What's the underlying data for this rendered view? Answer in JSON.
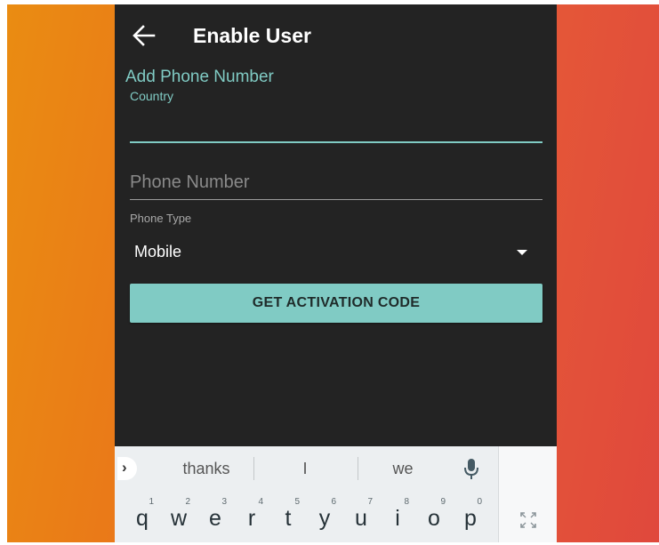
{
  "app_bar": {
    "back_icon": "arrow-left-icon",
    "title": "Enable User"
  },
  "form": {
    "section_title": "Add Phone Number",
    "country_label": "Country",
    "country_value": "",
    "phone_placeholder": "Phone Number",
    "phone_type_label": "Phone Type",
    "phone_type_value": "Mobile",
    "dropdown_icon": "caret-down-icon",
    "activation_button_label": "GET ACTIVATION CODE"
  },
  "keyboard": {
    "expand_icon": "chevron-right-icon",
    "suggestions": [
      "thanks",
      "I",
      "we"
    ],
    "mic_icon": "microphone-icon",
    "fullscreen_icon": "fullscreen-icon",
    "keys": [
      {
        "letter": "q",
        "hint": "1"
      },
      {
        "letter": "w",
        "hint": "2"
      },
      {
        "letter": "e",
        "hint": "3"
      },
      {
        "letter": "r",
        "hint": "4"
      },
      {
        "letter": "t",
        "hint": "5"
      },
      {
        "letter": "y",
        "hint": "6"
      },
      {
        "letter": "u",
        "hint": "7"
      },
      {
        "letter": "i",
        "hint": "8"
      },
      {
        "letter": "o",
        "hint": "9"
      },
      {
        "letter": "p",
        "hint": "0"
      }
    ]
  },
  "colors": {
    "accent": "#80cbc4",
    "app_background": "#232323",
    "keyboard_background": "#eceff1",
    "wallpaper_left": "#ea8c12",
    "wallpaper_right": "#e0483c"
  }
}
